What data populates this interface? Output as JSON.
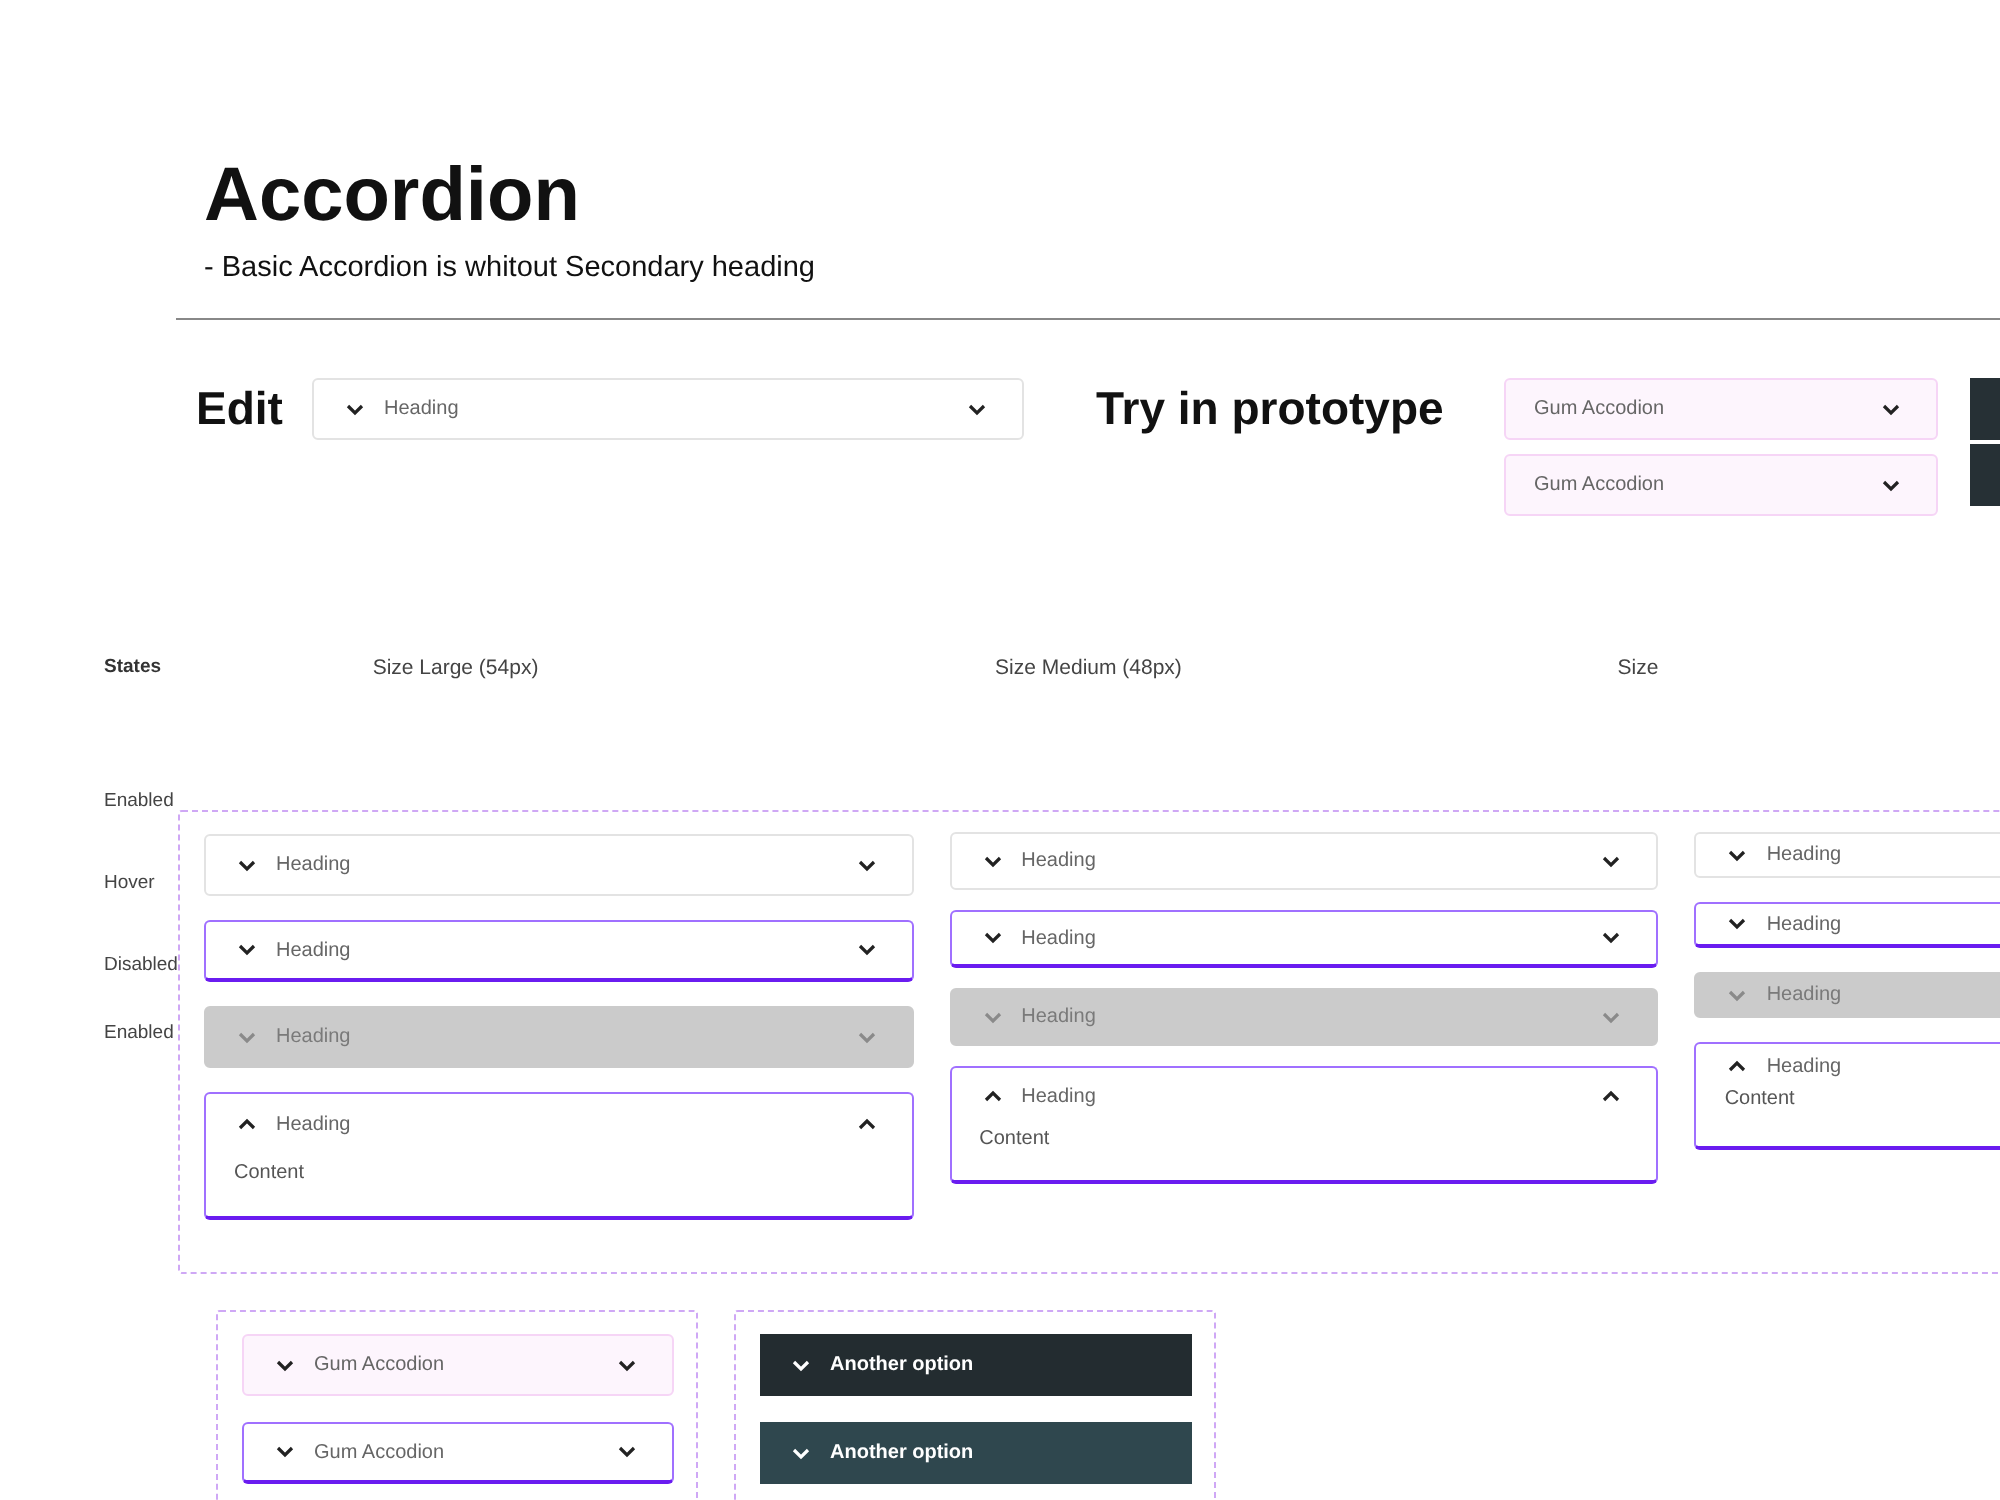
{
  "title": "Accordion",
  "note": "- Basic Accordion is whitout Secondary heading",
  "edit": {
    "label": "Edit",
    "accordion": {
      "kind": "enabled",
      "heading": "Heading"
    }
  },
  "prototype": {
    "label": "Try in prototype",
    "accordions": [
      {
        "kind": "gum-plain",
        "heading": "Gum Accodion"
      },
      {
        "kind": "gum-plain",
        "heading": "Gum Accodion"
      }
    ]
  },
  "states_label": "States",
  "sizes": [
    {
      "label": "Size Large (54px)"
    },
    {
      "label": "Size Medium (48px)"
    },
    {
      "label": "Size"
    }
  ],
  "state_labels": [
    "Enabled",
    "Hover",
    "Disabled",
    "Enabled"
  ],
  "columns": [
    {
      "items": [
        {
          "kind": "enabled",
          "heading": "Heading"
        },
        {
          "kind": "hover",
          "heading": "Heading"
        },
        {
          "kind": "disabled",
          "heading": "Heading"
        },
        {
          "kind": "expanded",
          "heading": "Heading",
          "content": "Content"
        }
      ]
    },
    {
      "items": [
        {
          "kind": "enabled",
          "heading": "Heading"
        },
        {
          "kind": "hover",
          "heading": "Heading"
        },
        {
          "kind": "disabled",
          "heading": "Heading"
        },
        {
          "kind": "expanded",
          "heading": "Heading",
          "content": "Content"
        }
      ]
    },
    {
      "items": [
        {
          "kind": "enabled",
          "heading": "Heading"
        },
        {
          "kind": "hover",
          "heading": "Heading"
        },
        {
          "kind": "disabled",
          "heading": "Heading"
        },
        {
          "kind": "expanded",
          "heading": "Heading",
          "content": "Content"
        }
      ]
    }
  ],
  "variants": [
    {
      "items": [
        {
          "kind": "gum",
          "heading": "Gum Accodion"
        },
        {
          "kind": "hover",
          "heading": "Gum Accodion"
        }
      ]
    },
    {
      "items": [
        {
          "kind": "dark",
          "heading": "Another option"
        },
        {
          "kind": "dark-alt",
          "heading": "Another option"
        }
      ]
    }
  ]
}
